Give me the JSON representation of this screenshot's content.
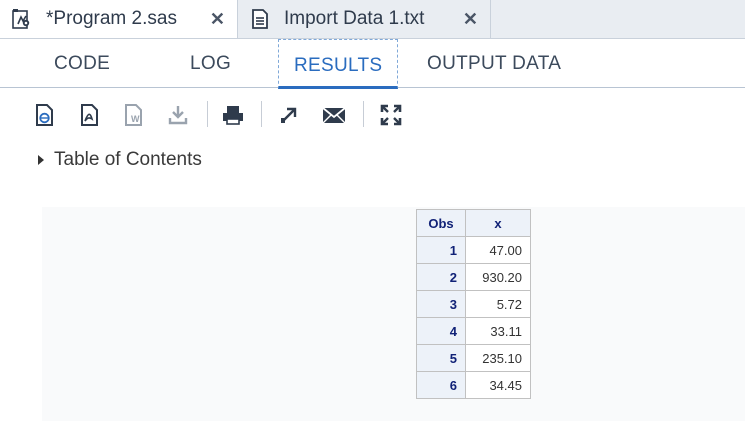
{
  "file_tabs": [
    {
      "title": "*Program 2.sas",
      "icon": "sas-program-icon",
      "active": true
    },
    {
      "title": "Import Data 1.txt",
      "icon": "text-file-icon",
      "active": false
    }
  ],
  "close_glyph": "✕",
  "view_tabs": [
    "CODE",
    "LOG",
    "RESULTS",
    "OUTPUT DATA"
  ],
  "selected_view": "RESULTS",
  "toolbar_icons": [
    "download-html-icon",
    "download-pdf-icon",
    "download-rtf-icon",
    "download-icon",
    "print-icon",
    "open-new-window-icon",
    "email-icon",
    "maximize-icon"
  ],
  "toc_label": "Table of Contents",
  "results_table": {
    "headers": [
      "Obs",
      "x"
    ],
    "rows": [
      {
        "obs": "1",
        "x": "47.00"
      },
      {
        "obs": "2",
        "x": "930.20"
      },
      {
        "obs": "3",
        "x": "5.72"
      },
      {
        "obs": "4",
        "x": "33.11"
      },
      {
        "obs": "5",
        "x": "235.10"
      },
      {
        "obs": "6",
        "x": "34.45"
      }
    ]
  },
  "colors": {
    "accent": "#2a6cbf",
    "tab_bar": "#e9edf2",
    "table_header": "#edf2f9",
    "table_header_text": "#112277"
  }
}
